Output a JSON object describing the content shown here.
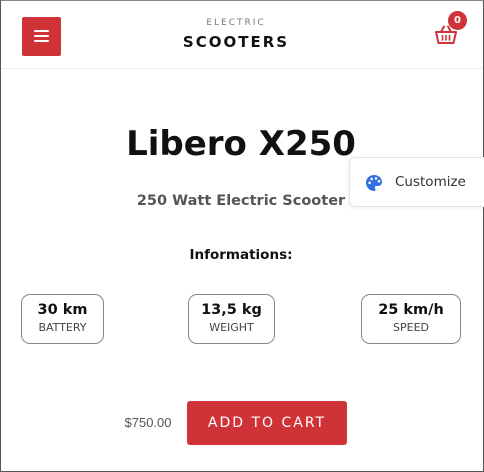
{
  "header": {
    "logo_small": "ELECTRIC",
    "logo_big": "SCOOTERS",
    "cart_count": "0"
  },
  "product": {
    "title": "Libero X250",
    "subtitle": "250 Watt Electric Scooter"
  },
  "customize": {
    "label": "Customize"
  },
  "info": {
    "heading": "Informations:",
    "specs": [
      {
        "value": "30 km",
        "label": "BATTERY"
      },
      {
        "value": "13,5 kg",
        "label": "WEIGHT"
      },
      {
        "value": "25 km/h",
        "label": "SPEED"
      }
    ]
  },
  "purchase": {
    "price": "$750.00",
    "button_label": "ADD TO CART"
  },
  "colors": {
    "accent": "#cf3337",
    "customize_icon": "#2f6fe0"
  }
}
